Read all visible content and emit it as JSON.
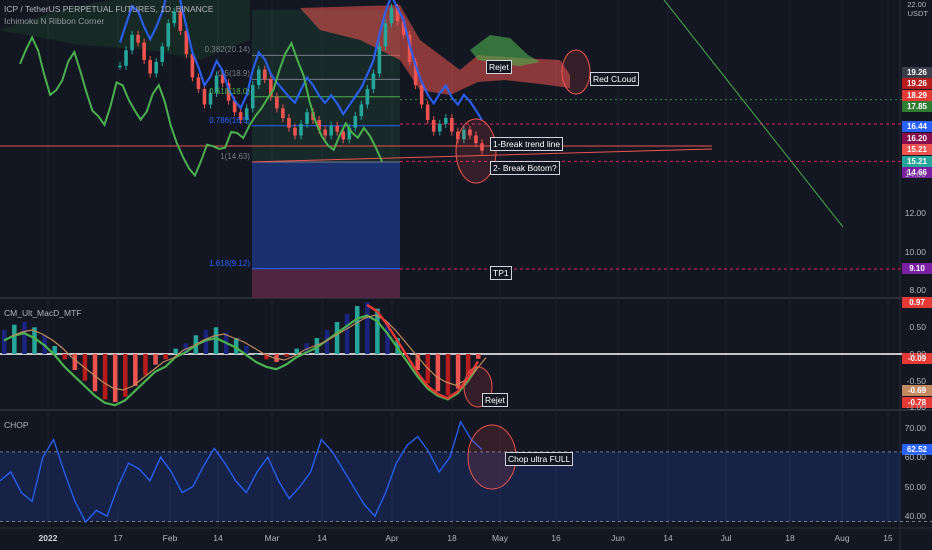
{
  "header": {
    "symbol": "ICP / TetherUS PERPETUAL FUTURES, 1D, BINANCE",
    "indicator": "Ichimoku N Ribbon Corner",
    "currency": "USDT"
  },
  "panes": {
    "macd_label": "CM_Ult_MacD_MTF",
    "chop_label": "CHOP"
  },
  "annotations": {
    "rejet1": "Rejet",
    "red_cloud": "Red CLoud",
    "break_trend": "1-Break trend line",
    "break_bottom": "2- Break Botom?",
    "tp1": "TP1",
    "rejet2": "Rejet",
    "chop_full": "Chop ultra FULL"
  },
  "fib_levels": [
    {
      "label": "0.382(20.14)",
      "value": 20.14
    },
    {
      "label": "0.5(18.9)",
      "value": 18.9
    },
    {
      "label": "0.618(18.0)",
      "value": 18.0
    },
    {
      "label": "0.786(16.5)",
      "value": 16.5
    },
    {
      "label": "1(14.63)",
      "value": 14.63
    },
    {
      "label": "1.618(9.12)",
      "value": 9.12
    }
  ],
  "price_axis": {
    "ticks": [
      "14.00",
      "12.00",
      "10.00",
      "8.00"
    ],
    "top_tick": "22.00",
    "tags": [
      {
        "text": "19.26",
        "bg": "#3a3e4a",
        "value": 19.26
      },
      {
        "text": "19.26",
        "bg": "#b71c1c",
        "value": 18.95
      },
      {
        "text": "18.29",
        "bg": "#e53935",
        "value": 18.29
      },
      {
        "text": "17.85",
        "bg": "#2e7d32",
        "value": 17.85
      },
      {
        "text": "16.44",
        "bg": "#2962ff",
        "value": 16.44
      },
      {
        "text": "16.20",
        "bg": "#880e4f",
        "value": 16.2
      },
      {
        "text": "15.21",
        "bg": "#ef5350",
        "value": 15.52
      },
      {
        "text": "15.21",
        "bg": "#26a69a",
        "value": 15.0
      },
      {
        "text": "14.66",
        "bg": "#7b1fa2",
        "value": 14.66
      },
      {
        "text": "9.10",
        "bg": "#7b1fa2",
        "value": 9.1
      }
    ]
  },
  "macd_axis": {
    "ticks": [
      "0.50",
      "0.00",
      "-0.50",
      "-1.00"
    ],
    "tags": [
      {
        "text": "0.97",
        "bg": "#e53935",
        "value": 0.97
      },
      {
        "text": "-0.09",
        "bg": "#e53935",
        "value": -0.09
      },
      {
        "text": "-0.69",
        "bg": "#c28a5e",
        "value": -0.69
      },
      {
        "text": "-0.78",
        "bg": "#e53935",
        "value": -0.78
      }
    ]
  },
  "chop_axis": {
    "ticks": [
      "70.00",
      "60.00",
      "50.00",
      "40.00"
    ],
    "tags": [
      {
        "text": "62.52",
        "bg": "#2962ff",
        "value": 62.52
      }
    ]
  },
  "date_axis": [
    "2022",
    "17",
    "Feb",
    "14",
    "Mar",
    "14",
    "Apr",
    "18",
    "May",
    "16",
    "Jun",
    "14",
    "Jul",
    "18",
    "Aug",
    "15"
  ],
  "chart_data": {
    "type": "line",
    "title": "ICP / TetherUS PERPETUAL FUTURES, 1D, BINANCE",
    "price_range": [
      7.6,
      23.0
    ],
    "close": [
      19.6,
      20.4,
      21.2,
      20.8,
      19.9,
      19.2,
      19.8,
      20.6,
      21.8,
      22.4,
      21.4,
      20.2,
      19.0,
      18.4,
      17.6,
      18.2,
      19.1,
      18.7,
      17.8,
      17.2,
      16.8,
      17.4,
      18.6,
      19.4,
      18.9,
      18.0,
      17.4,
      16.9,
      16.4,
      16.0,
      16.6,
      17.2,
      16.8,
      16.3,
      16.0,
      16.5,
      16.2,
      15.8,
      16.4,
      17.0,
      17.6,
      18.4,
      19.2,
      20.6,
      21.8,
      22.6,
      21.9,
      21.2,
      19.8,
      18.6,
      17.6,
      16.8,
      16.2,
      16.6,
      16.9,
      16.2,
      15.8,
      16.3,
      16.0,
      15.6,
      15.21
    ],
    "macd_hist": [
      0.45,
      0.55,
      0.6,
      0.5,
      0.35,
      0.15,
      -0.1,
      -0.3,
      -0.5,
      -0.7,
      -0.85,
      -0.9,
      -0.8,
      -0.6,
      -0.4,
      -0.2,
      -0.1,
      0.1,
      0.2,
      0.35,
      0.45,
      0.5,
      0.4,
      0.3,
      0.15,
      0.0,
      -0.1,
      -0.15,
      -0.05,
      0.1,
      0.2,
      0.3,
      0.45,
      0.6,
      0.75,
      0.9,
      0.97,
      0.85,
      0.6,
      0.3,
      0.0,
      -0.3,
      -0.55,
      -0.7,
      -0.78,
      -0.65,
      -0.4,
      -0.09
    ],
    "chop": [
      52,
      55,
      48,
      45,
      60,
      66,
      55,
      45,
      38,
      42,
      40,
      50,
      58,
      56,
      52,
      60,
      55,
      48,
      50,
      57,
      63,
      58,
      52,
      48,
      55,
      60,
      52,
      46,
      50,
      55,
      66,
      62,
      56,
      50,
      44,
      40,
      48,
      58,
      64,
      67,
      62,
      55,
      60,
      72,
      66,
      62.52
    ],
    "chop_range": [
      36,
      76
    ],
    "macd_range": [
      -1.05,
      1.05
    ]
  }
}
